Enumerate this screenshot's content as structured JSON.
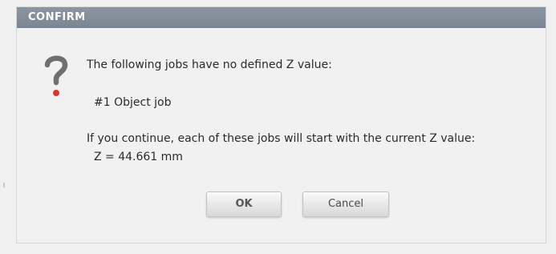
{
  "dialog": {
    "title": "CONFIRM",
    "icon": "question-mark-icon",
    "message_line1": "The following jobs have no defined Z value:",
    "job_item": "#1 Object job",
    "message_line2": "If you continue, each of these jobs will start with the current Z value:",
    "z_value": "Z = 44.661 mm",
    "buttons": {
      "ok_label": "OK",
      "cancel_label": "Cancel"
    }
  },
  "colors": {
    "titlebar": "#7f8996",
    "icon_gray": "#6f6f6f",
    "icon_dot": "#d9372c",
    "dialog_bg": "#f1f1f1"
  }
}
